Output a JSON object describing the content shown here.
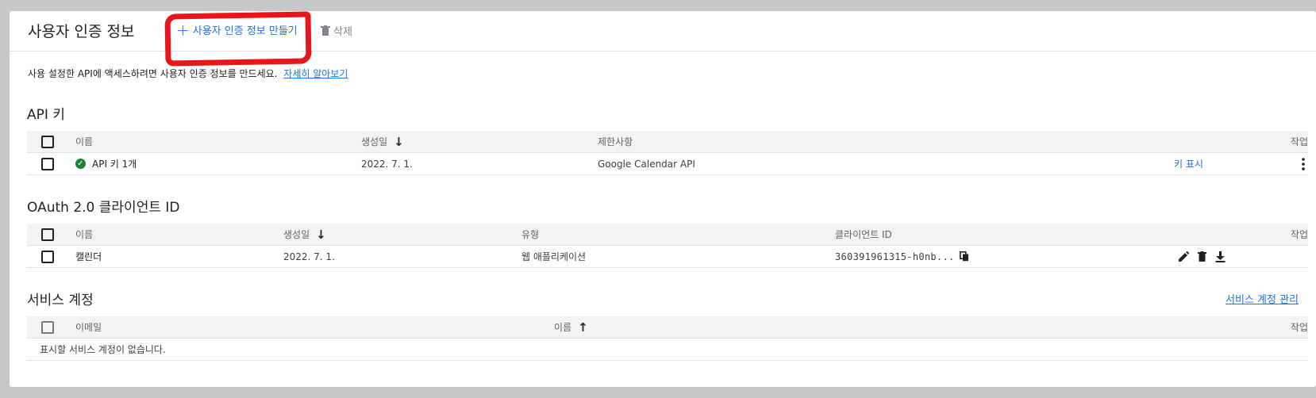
{
  "header": {
    "title": "사용자 인증 정보",
    "create_label": "사용자 인증 정보 만들기",
    "delete_label": "삭제"
  },
  "intro": {
    "text": "사용 설정한 API에 액세스하려면 사용자 인증 정보를 만드세요.",
    "learn_more": "자세히 알아보기"
  },
  "api_keys": {
    "title": "API 키",
    "columns": {
      "name": "이름",
      "created": "생성일",
      "restrictions": "제한사항",
      "actions": "작업"
    },
    "rows": [
      {
        "name": "API 키 1개",
        "created": "2022. 7. 1.",
        "restrictions": "Google Calendar API",
        "show_key": "키 표시"
      }
    ]
  },
  "oauth": {
    "title": "OAuth 2.0 클라이언트 ID",
    "columns": {
      "name": "이름",
      "created": "생성일",
      "type": "유형",
      "client_id": "클라이언트 ID",
      "actions": "작업"
    },
    "rows": [
      {
        "name": "캘린더",
        "created": "2022. 7. 1.",
        "type": "웹 애플리케이션",
        "client_id": "360391961315-h0nb..."
      }
    ]
  },
  "service_accounts": {
    "title": "서비스 계정",
    "manage_label": "서비스 계정 관리",
    "columns": {
      "email": "이메일",
      "name": "이름",
      "actions": "작업"
    },
    "empty_text": "표시할 서비스 계정이 없습니다."
  },
  "colors": {
    "accent": "#1a73e8",
    "highlight": "#e8151b",
    "success": "#188038"
  }
}
